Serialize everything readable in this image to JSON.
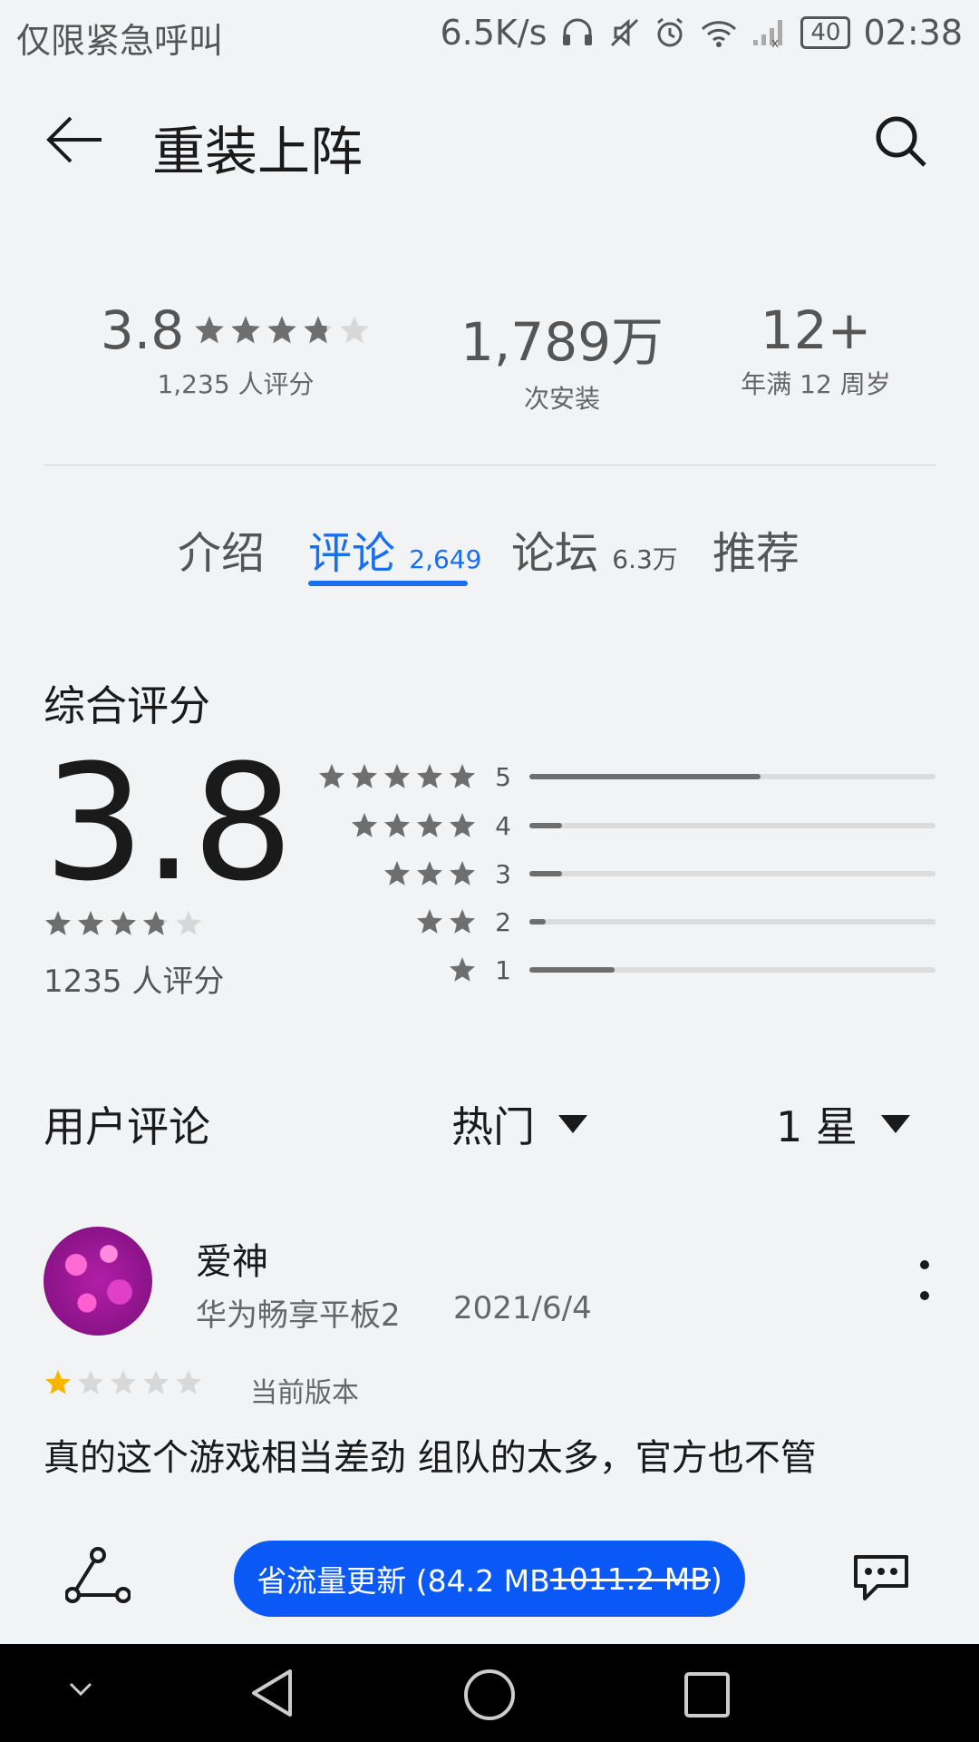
{
  "status_bar": {
    "carrier": "仅限紧急呼叫",
    "speed": "6.5K/s",
    "battery": "40",
    "time": "02:38",
    "icons": [
      "headphones-icon",
      "mute-icon",
      "alarm-icon",
      "wifi-icon",
      "signal-icon",
      "battery-icon"
    ]
  },
  "header": {
    "title": "重装上阵"
  },
  "stats": {
    "rating_value": "3.8",
    "rating_count": "1,235 人评分",
    "installs_value": "1,789万",
    "installs_label": "次安装",
    "age_value": "12+",
    "age_label": "年满 12 周岁"
  },
  "tabs": [
    {
      "label": "介绍",
      "count": ""
    },
    {
      "label": "评论",
      "count": "2,649",
      "active": true
    },
    {
      "label": "论坛",
      "count": "6.3万"
    },
    {
      "label": "推荐",
      "count": ""
    }
  ],
  "overall": {
    "title": "综合评分",
    "score": "3.8",
    "count_text": "1235 人评分",
    "stars": 3.8,
    "distribution": [
      {
        "stars": "5",
        "fraction": 0.57
      },
      {
        "stars": "4",
        "fraction": 0.08
      },
      {
        "stars": "3",
        "fraction": 0.08
      },
      {
        "stars": "2",
        "fraction": 0.04
      },
      {
        "stars": "1",
        "fraction": 0.21
      }
    ]
  },
  "reviews_header": {
    "title": "用户评论",
    "sort_label": "热门",
    "filter_label": "1 星"
  },
  "review": {
    "name": "爱神",
    "device": "华为畅享平板2",
    "date": "2021/6/4",
    "stars": 1,
    "version_tag": "当前版本",
    "text": "真的这个游戏相当差劲  组队的太多，官方也不管"
  },
  "bottom_bar": {
    "update_prefix": "省流量更新 (84.2 MB ",
    "update_strike": "1011.2 MB",
    "update_suffix": ")",
    "accent": "#0a59f7"
  },
  "colors": {
    "accent_blue": "#1a6ef0",
    "star_gray": "#6e6e6e",
    "star_gold": "#f7b500"
  }
}
